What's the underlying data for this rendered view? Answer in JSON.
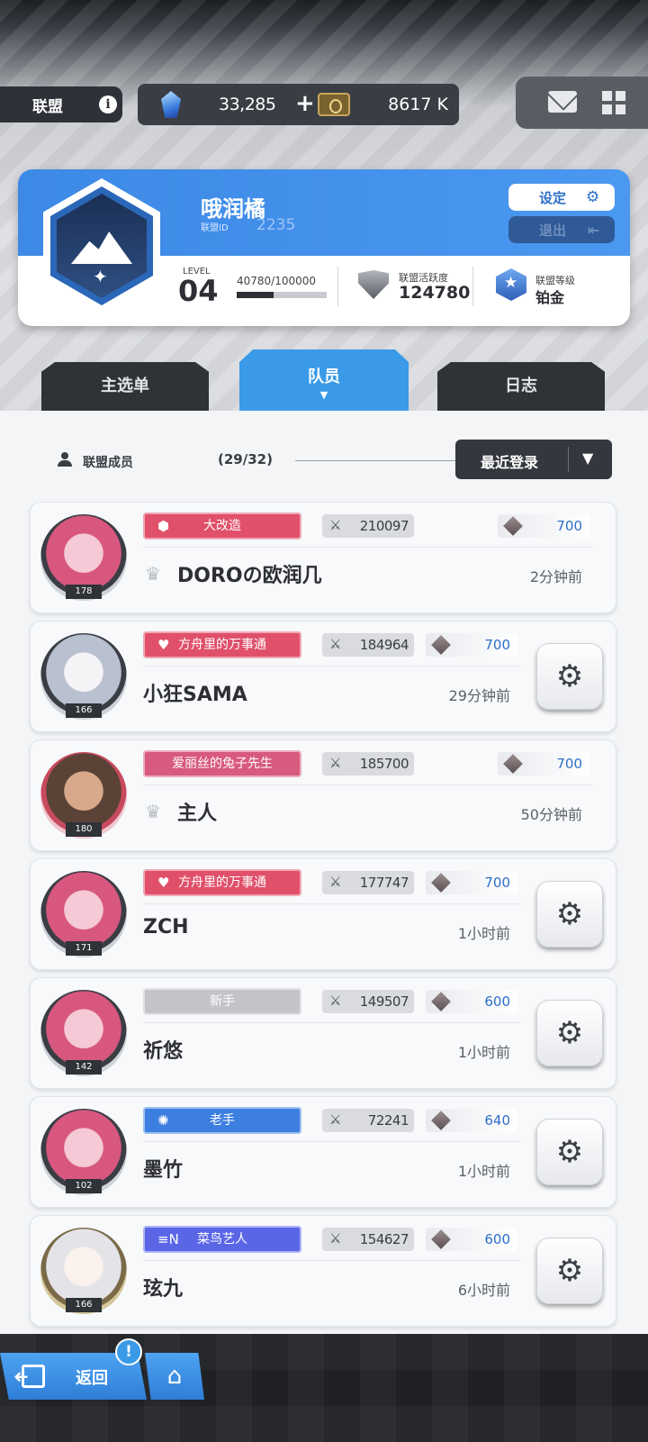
{
  "topbar": {
    "alliance_label": "联盟",
    "info_icon": "i",
    "gems": "33,285",
    "add_symbol": "+",
    "credits": "8617 K"
  },
  "alliance": {
    "name": "哦润橘",
    "id_label": "联盟ID",
    "id": "2235",
    "settings_label": "设定",
    "exit_label": "退出",
    "level_label": "LEVEL",
    "level": "04",
    "exp": "40780/100000",
    "exp_fraction": 0.4078,
    "activity_label": "联盟活跃度",
    "activity": "124780",
    "rank_label": "联盟等级",
    "rank": "铂金"
  },
  "tabs": {
    "main": "主选单",
    "members": "队员",
    "log": "日志",
    "caret": "▼"
  },
  "members": {
    "label": "联盟成员",
    "count": "(29/32)",
    "sort_label": "最近登录",
    "sort_arrow": "▼",
    "list": [
      {
        "level": "178",
        "title": "大改造",
        "title_icon": "⬢",
        "power": "210097",
        "contrib": "700",
        "name": "DOROの欧润几",
        "time": "2分钟前",
        "crown": true,
        "gear": false
      },
      {
        "level": "166",
        "title": "方舟里的万事通",
        "title_icon": "♥",
        "power": "184964",
        "contrib": "700",
        "name": "小狂SAMA",
        "time": "29分钟前",
        "crown": false,
        "gear": true
      },
      {
        "level": "180",
        "title": "爱丽丝的兔子先生",
        "title_icon": "",
        "power": "185700",
        "contrib": "700",
        "name": "主人",
        "time": "50分钟前",
        "crown": true,
        "gear": false
      },
      {
        "level": "171",
        "title": "方舟里的万事通",
        "title_icon": "♥",
        "power": "177747",
        "contrib": "700",
        "name": "ZCH",
        "time": "1小时前",
        "crown": false,
        "gear": true
      },
      {
        "level": "142",
        "title": "新手",
        "title_icon": "",
        "power": "149507",
        "contrib": "600",
        "name": "祈悠",
        "time": "1小时前",
        "crown": false,
        "gear": true
      },
      {
        "level": "102",
        "title": "老手",
        "title_icon": "✺",
        "power": "72241",
        "contrib": "640",
        "name": "墨竹",
        "time": "1小时前",
        "crown": false,
        "gear": true
      },
      {
        "level": "166",
        "title": "菜鸟艺人",
        "title_icon": "≡N",
        "power": "154627",
        "contrib": "600",
        "name": "玹九",
        "time": "6小时前",
        "crown": false,
        "gear": true
      }
    ]
  },
  "bottom": {
    "back_label": "返回",
    "alert": "!"
  },
  "icons": {
    "gear": "⚙",
    "crown": "♛",
    "sword": "⚔",
    "home": "⌂"
  }
}
